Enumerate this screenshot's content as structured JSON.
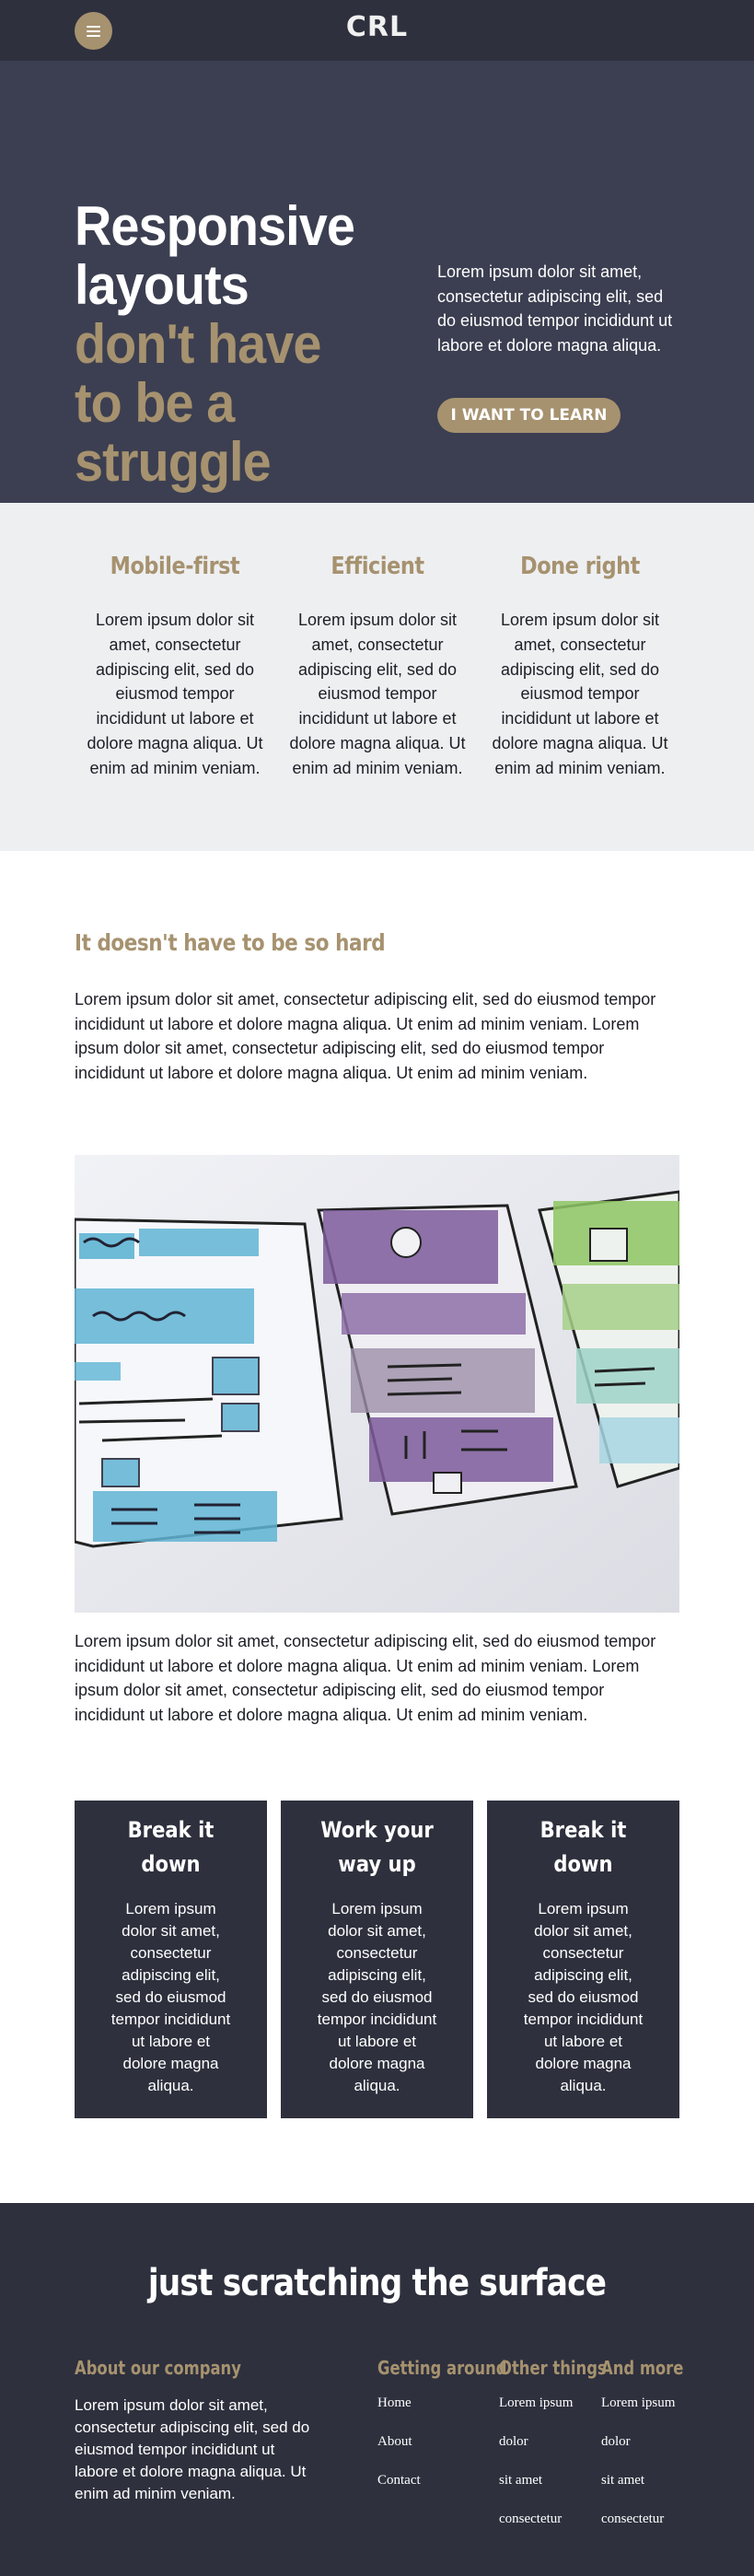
{
  "nav": {
    "logo": "CRL"
  },
  "hero": {
    "title_white_1": "Responsive",
    "title_white_2": "layouts",
    "title_gold_1": "don't have",
    "title_gold_2": "to be a",
    "title_gold_3": "struggle",
    "copy": "Lorem ipsum dolor sit amet, consectetur adipiscing elit, sed do eiusmod tempor incididunt ut labore et dolore magna aliqua.",
    "cta": "I WANT TO LEARN"
  },
  "features": [
    {
      "title": "Mobile-first",
      "text": "Lorem ipsum dolor sit amet, consectetur adipiscing elit, sed do eiusmod tempor incididunt ut labore et dolore magna aliqua. Ut enim ad minim veniam."
    },
    {
      "title": "Efficient",
      "text": "Lorem ipsum dolor sit amet, consectetur adipiscing elit, sed do eiusmod tempor incididunt ut labore et dolore magna aliqua. Ut enim ad minim veniam."
    },
    {
      "title": "Done right",
      "text": "Lorem ipsum dolor sit amet, consectetur adipiscing elit, sed do eiusmod tempor incididunt ut labore et dolore magna aliqua. Ut enim ad minim veniam."
    }
  ],
  "article": {
    "heading": "It doesn't have to be so hard",
    "para1": "Lorem ipsum dolor sit amet, consectetur adipiscing elit, sed do eiusmod tempor incididunt ut labore et dolore magna aliqua. Ut enim ad minim veniam. Lorem ipsum dolor sit amet, consectetur adipiscing elit, sed do eiusmod tempor incididunt ut labore et dolore magna aliqua. Ut enim ad minim veniam.",
    "para2": "Lorem ipsum dolor sit amet, consectetur adipiscing elit, sed do eiusmod tempor incididunt ut labore et dolore magna aliqua. Ut enim ad minim veniam. Lorem ipsum dolor sit amet, consectetur adipiscing elit, sed do eiusmod tempor incididunt ut labore et dolore magna aliqua. Ut enim ad minim veniam."
  },
  "cards": [
    {
      "title": "Break it down",
      "text": "Lorem ipsum dolor sit amet, consectetur adipiscing elit, sed do eiusmod tempor incididunt ut labore et dolore magna aliqua."
    },
    {
      "title": "Work your way up",
      "text": "Lorem ipsum dolor sit amet, consectetur adipiscing elit, sed do eiusmod tempor incididunt ut labore et dolore magna aliqua."
    },
    {
      "title": "Break it down",
      "text": "Lorem ipsum dolor sit amet, consectetur adipiscing elit, sed do eiusmod tempor incididunt ut labore et dolore magna aliqua."
    }
  ],
  "footer": {
    "title": "just scratching the surface",
    "about_heading": "About our company",
    "about_text": "Lorem ipsum dolor sit amet, consectetur adipiscing elit, sed do eiusmod tempor incididunt ut labore et dolore magna aliqua. Ut enim ad minim veniam.",
    "getting_around_heading": "Getting around",
    "getting_around": [
      "Home",
      "About",
      "Contact"
    ],
    "other_things_heading": "Other things",
    "other_things": [
      "Lorem ipsum",
      "dolor",
      "sit amet",
      "consectetur"
    ],
    "and_more_heading": "And more",
    "and_more": [
      "Lorem ipsum",
      "dolor",
      "sit amet",
      "consectetur"
    ]
  },
  "colors": {
    "nav_bg": "#2e303d",
    "hero_bg": "#3c3f51",
    "accent_gold": "#a6926f",
    "features_bg": "#eeeff1",
    "card_bg": "#2e303d"
  },
  "icons": {
    "menu": "hamburger-menu-icon"
  }
}
